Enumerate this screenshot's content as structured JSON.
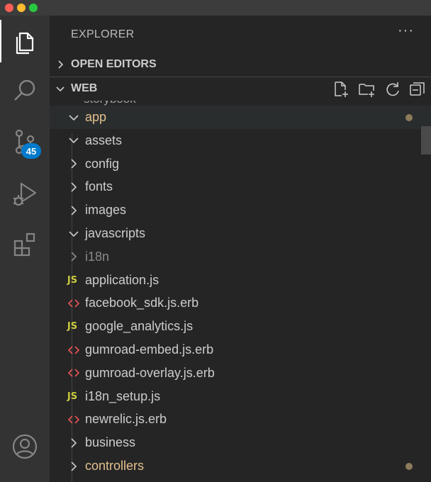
{
  "window": {
    "traffic_lights": [
      "close",
      "minimize",
      "maximize"
    ]
  },
  "activity_bar": {
    "items": [
      {
        "name": "explorer",
        "icon": "files-icon",
        "active": true
      },
      {
        "name": "search",
        "icon": "search-icon"
      },
      {
        "name": "source-control",
        "icon": "source-control-icon",
        "badge": "45"
      },
      {
        "name": "run-debug",
        "icon": "run-debug-icon"
      },
      {
        "name": "extensions",
        "icon": "extensions-icon"
      },
      {
        "name": "accounts",
        "icon": "account-icon"
      }
    ]
  },
  "sidebar": {
    "title": "EXPLORER",
    "more": "···",
    "sections": {
      "open_editors": "OPEN EDITORS",
      "workspace": "WEB"
    },
    "toolbar": [
      "new-file-icon",
      "new-folder-icon",
      "refresh-icon",
      "collapse-all-icon"
    ]
  },
  "tree": {
    "clipped_row": "storybook",
    "rows": [
      {
        "label": "app",
        "kind": "folder",
        "expanded": true,
        "depth": 0,
        "modified": true,
        "color": "#e2c08d",
        "selected": true
      },
      {
        "label": "assets",
        "kind": "folder",
        "expanded": true,
        "depth": 0
      },
      {
        "label": "config",
        "kind": "folder",
        "expanded": false,
        "depth": 0
      },
      {
        "label": "fonts",
        "kind": "folder",
        "expanded": false,
        "depth": 0
      },
      {
        "label": "images",
        "kind": "folder",
        "expanded": false,
        "depth": 0
      },
      {
        "label": "javascripts",
        "kind": "folder",
        "expanded": true,
        "depth": 0
      },
      {
        "label": "i18n",
        "kind": "folder",
        "expanded": false,
        "depth": 0,
        "dim": true
      },
      {
        "label": "application.js",
        "kind": "js",
        "depth": 0
      },
      {
        "label": "facebook_sdk.js.erb",
        "kind": "erb",
        "depth": 0
      },
      {
        "label": "google_analytics.js",
        "kind": "js",
        "depth": 0
      },
      {
        "label": "gumroad-embed.js.erb",
        "kind": "erb",
        "depth": 0
      },
      {
        "label": "gumroad-overlay.js.erb",
        "kind": "erb",
        "depth": 0
      },
      {
        "label": "i18n_setup.js",
        "kind": "js",
        "depth": 0
      },
      {
        "label": "newrelic.js.erb",
        "kind": "erb",
        "depth": 0
      },
      {
        "label": "business",
        "kind": "folder",
        "expanded": false,
        "depth": 0
      },
      {
        "label": "controllers",
        "kind": "folder",
        "expanded": false,
        "depth": 0,
        "modified": true,
        "color": "#e2c08d"
      }
    ]
  },
  "colors": {
    "activity_bar": "#333333",
    "sidebar": "#252526",
    "badge": "#007acc",
    "js_icon": "#cbcb41",
    "erb_icon": "#e05252",
    "modified_folder": "#e2c08d",
    "modified_dot": "#8c7b5a"
  }
}
